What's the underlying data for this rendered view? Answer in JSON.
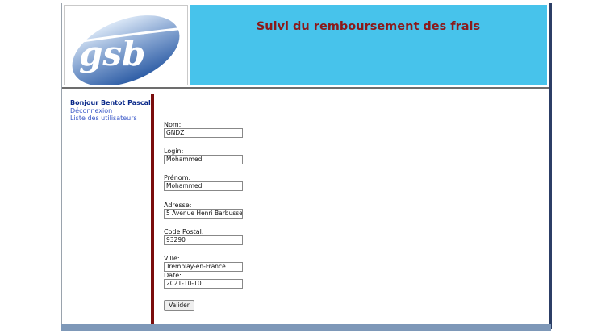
{
  "header": {
    "logo_text": "gsb",
    "title": "Suivi du remboursement des frais"
  },
  "menu": {
    "greeting": "Bonjour Bentot Pascal",
    "logout": "Déconnexion",
    "users_link": "Liste des utilisateurs"
  },
  "form": {
    "nom_label": "Nom:",
    "nom_value": "GNDZ",
    "login_label": "Login:",
    "login_value": "Mohammed",
    "prenom_label": "Prénom:",
    "prenom_value": "Mohammed",
    "adresse_label": "Adresse:",
    "adresse_value": "5 Avenue Henri Barbusse",
    "cp_label": "Code Postal:",
    "cp_value": "93290",
    "ville_label": "Ville:",
    "ville_value": "Tremblay-en-France",
    "date_label": "Date:",
    "date_value": "2021-10-10",
    "submit_label": "Valider"
  },
  "colors": {
    "header_bg": "#47c3eb",
    "title_color": "#8b1a1a",
    "sidebar_bar": "#7a0d0d"
  }
}
